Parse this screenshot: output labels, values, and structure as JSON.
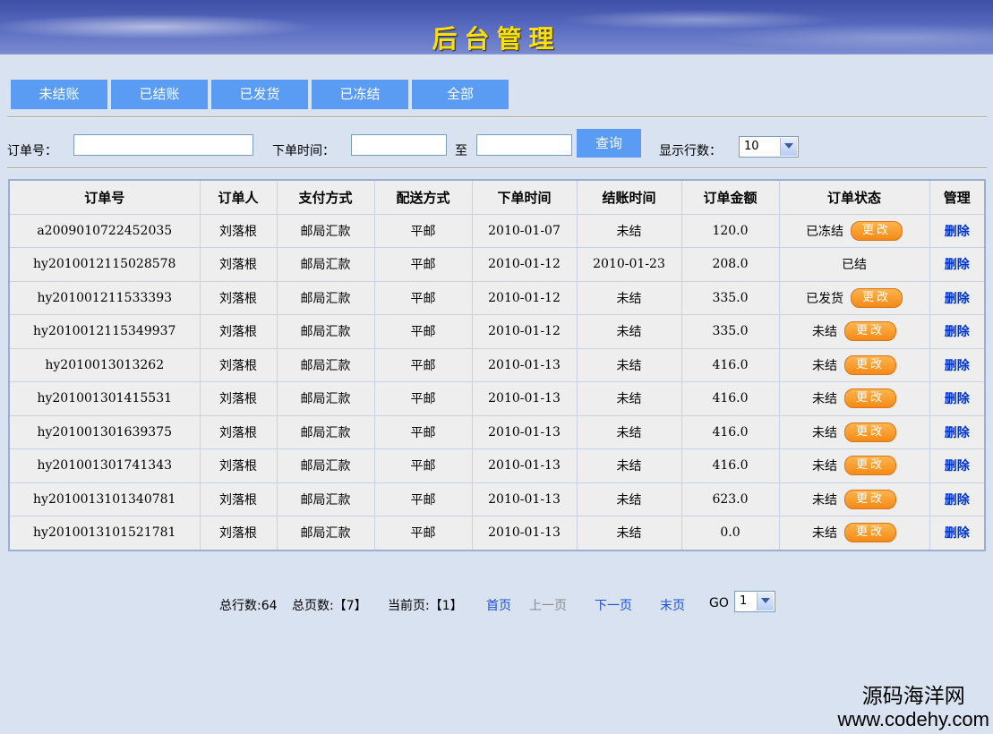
{
  "header": {
    "title": "后台管理"
  },
  "status_tabs": [
    "未结账",
    "已结账",
    "已发货",
    "已冻结",
    "全部"
  ],
  "search": {
    "order_no_label": "订单号：",
    "order_no_value": "",
    "order_time_label": "下单时间：",
    "date_from": "",
    "to_label": "至",
    "date_to": "",
    "query_button": "查询",
    "rows_label": "显示行数：",
    "rows_value": "10"
  },
  "table": {
    "headers": [
      "订单号",
      "订单人",
      "支付方式",
      "配送方式",
      "下单时间",
      "结账时间",
      "订单金额",
      "订单状态",
      "管理"
    ],
    "change_label": "更改",
    "delete_label": "删除",
    "rows": [
      {
        "order_no": "a2009010722452035",
        "customer": "刘落根",
        "payment": "邮局汇款",
        "delivery": "平邮",
        "order_time": "2010-01-07",
        "settle_time": "未结",
        "amount": "120.0",
        "state": "已冻结",
        "changeable": true
      },
      {
        "order_no": "hy2010012115028578",
        "customer": "刘落根",
        "payment": "邮局汇款",
        "delivery": "平邮",
        "order_time": "2010-01-12",
        "settle_time": "2010-01-23",
        "amount": "208.0",
        "state": "已结",
        "changeable": false
      },
      {
        "order_no": "hy201001211533393",
        "customer": "刘落根",
        "payment": "邮局汇款",
        "delivery": "平邮",
        "order_time": "2010-01-12",
        "settle_time": "未结",
        "amount": "335.0",
        "state": "已发货",
        "changeable": true
      },
      {
        "order_no": "hy2010012115349937",
        "customer": "刘落根",
        "payment": "邮局汇款",
        "delivery": "平邮",
        "order_time": "2010-01-12",
        "settle_time": "未结",
        "amount": "335.0",
        "state": "未结",
        "changeable": true
      },
      {
        "order_no": "hy2010013013262",
        "customer": "刘落根",
        "payment": "邮局汇款",
        "delivery": "平邮",
        "order_time": "2010-01-13",
        "settle_time": "未结",
        "amount": "416.0",
        "state": "未结",
        "changeable": true
      },
      {
        "order_no": "hy201001301415531",
        "customer": "刘落根",
        "payment": "邮局汇款",
        "delivery": "平邮",
        "order_time": "2010-01-13",
        "settle_time": "未结",
        "amount": "416.0",
        "state": "未结",
        "changeable": true
      },
      {
        "order_no": "hy201001301639375",
        "customer": "刘落根",
        "payment": "邮局汇款",
        "delivery": "平邮",
        "order_time": "2010-01-13",
        "settle_time": "未结",
        "amount": "416.0",
        "state": "未结",
        "changeable": true
      },
      {
        "order_no": "hy201001301741343",
        "customer": "刘落根",
        "payment": "邮局汇款",
        "delivery": "平邮",
        "order_time": "2010-01-13",
        "settle_time": "未结",
        "amount": "416.0",
        "state": "未结",
        "changeable": true
      },
      {
        "order_no": "hy2010013101340781",
        "customer": "刘落根",
        "payment": "邮局汇款",
        "delivery": "平邮",
        "order_time": "2010-01-13",
        "settle_time": "未结",
        "amount": "623.0",
        "state": "未结",
        "changeable": true
      },
      {
        "order_no": "hy2010013101521781",
        "customer": "刘落根",
        "payment": "邮局汇款",
        "delivery": "平邮",
        "order_time": "2010-01-13",
        "settle_time": "未结",
        "amount": "0.0",
        "state": "未结",
        "changeable": true
      }
    ]
  },
  "pager": {
    "total_rows": "总行数:64",
    "total_pages": "总页数:【7】",
    "current_page": "当前页:【1】",
    "first": "首页",
    "prev": "上一页",
    "next": "下一页",
    "last": "末页",
    "go_label": "GO",
    "go_value": "1"
  },
  "watermark": {
    "cn": "源码海洋网",
    "url": "www.codehy.com"
  }
}
